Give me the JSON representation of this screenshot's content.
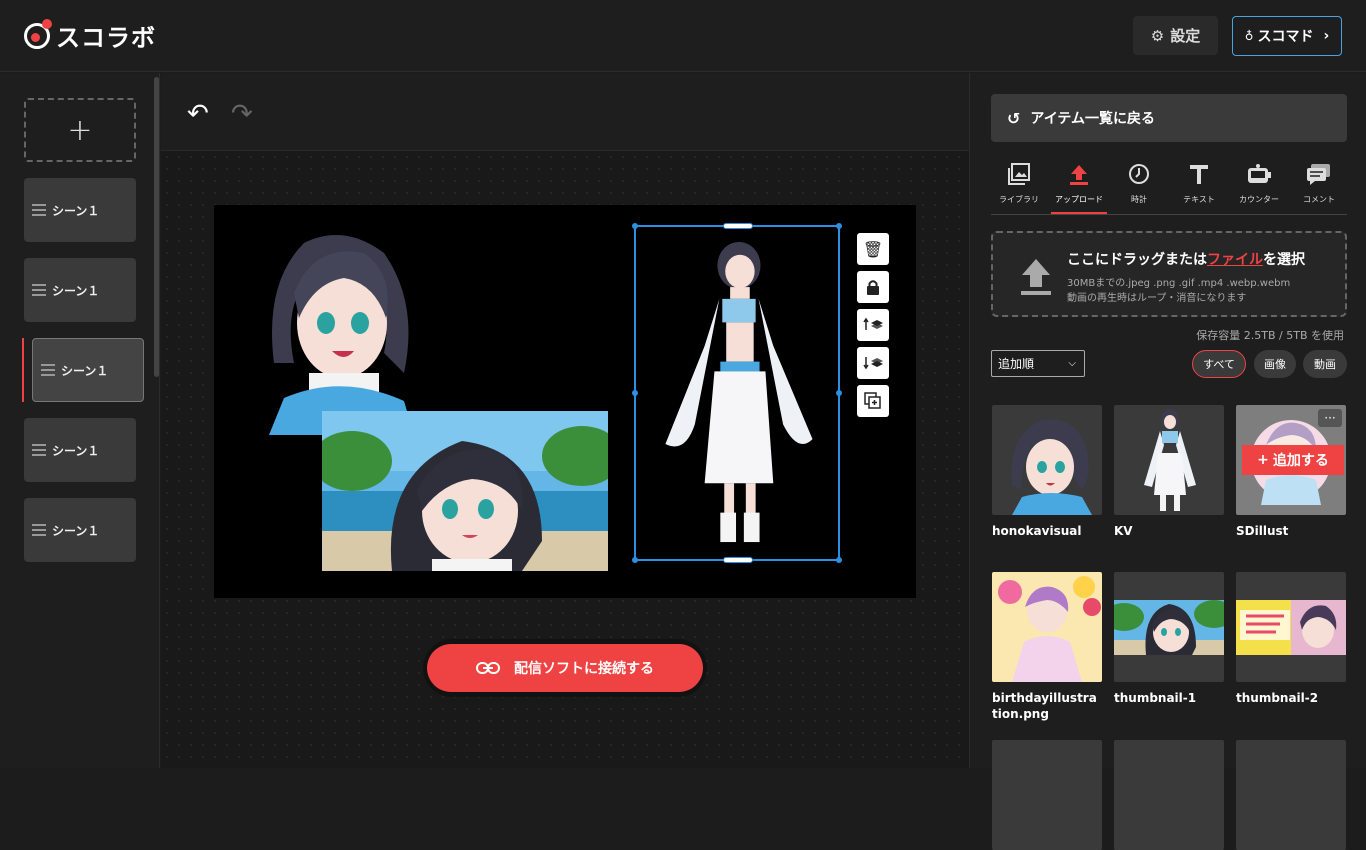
{
  "app": {
    "logo": "スコラボ"
  },
  "header": {
    "settings_label": "設定",
    "sukomado_label": "スコマド",
    "chevron": "›"
  },
  "scenes": {
    "add_label": "+",
    "items": [
      {
        "label": "シーン１"
      },
      {
        "label": "シーン１"
      },
      {
        "label": "シーン１"
      },
      {
        "label": "シーン１"
      },
      {
        "label": "シーン１"
      }
    ],
    "active_index": 2
  },
  "toolbar": {
    "undo": "↶",
    "redo": "↷"
  },
  "connect_button": "配信ソフトに接続する",
  "right": {
    "back_label": "アイテム一覧に戻る",
    "tabs": [
      {
        "label": "ライブラリ",
        "icon": "library-icon"
      },
      {
        "label": "アップロード",
        "icon": "upload-icon"
      },
      {
        "label": "時計",
        "icon": "clock-icon"
      },
      {
        "label": "テキスト",
        "icon": "text-icon"
      },
      {
        "label": "カウンター",
        "icon": "counter-icon"
      },
      {
        "label": "コメント",
        "icon": "comment-icon"
      }
    ],
    "active_tab": 1,
    "dropzone": {
      "title_pre": "ここにドラッグまたは",
      "title_link": "ファイル",
      "title_post": "を選択",
      "line1": "30MBまでの.jpeg .png .gif .mp4 .webp.webm",
      "line2": "動画の再生時はループ・消音になります"
    },
    "storage": "保存容量  2.5TB / 5TB を使用",
    "sort": "追加順",
    "filters": [
      {
        "label": "すべて"
      },
      {
        "label": "画像"
      },
      {
        "label": "動画"
      }
    ],
    "items": [
      {
        "name": "honokavisual"
      },
      {
        "name": "KV"
      },
      {
        "name": "SDillust"
      },
      {
        "name": "birthdayillustration.png"
      },
      {
        "name": "thumbnail-1"
      },
      {
        "name": "thumbnail-2"
      }
    ],
    "add_label": "追加する",
    "more": "···"
  },
  "colors": {
    "accent": "#ef4343",
    "select": "#2d8fe0"
  }
}
